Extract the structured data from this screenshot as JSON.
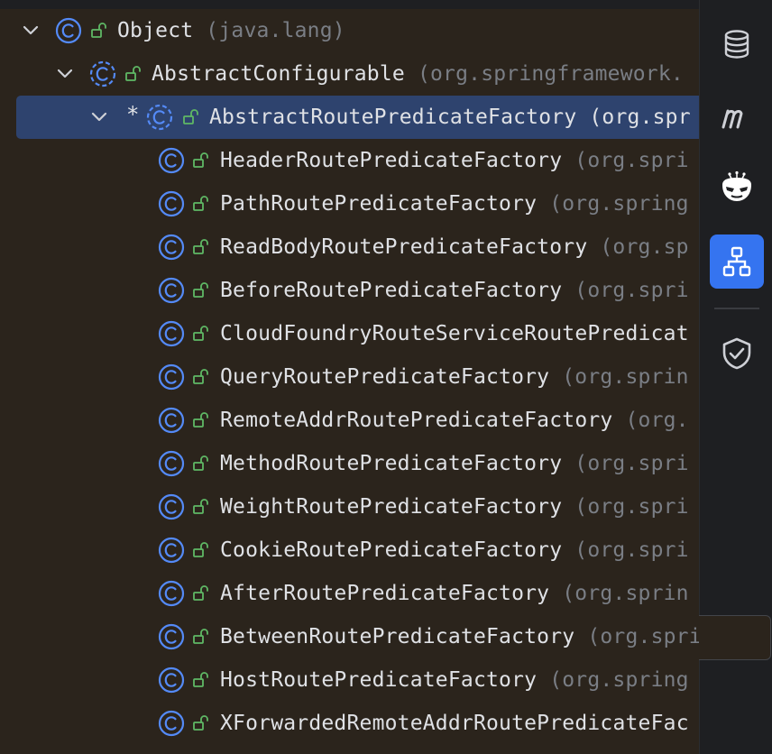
{
  "tree": {
    "rows": [
      {
        "name": "Object",
        "pkg": "(java.lang)",
        "chevron": true,
        "star": false,
        "selected": false
      },
      {
        "name": "AbstractConfigurable",
        "pkg": "(org.springframework.",
        "chevron": true,
        "star": false,
        "selected": false
      },
      {
        "name": "AbstractRoutePredicateFactory",
        "pkg": "(org.spr",
        "chevron": true,
        "star": true,
        "selected": true
      },
      {
        "name": "HeaderRoutePredicateFactory",
        "pkg": "(org.spri",
        "chevron": false,
        "star": false,
        "selected": false
      },
      {
        "name": "PathRoutePredicateFactory",
        "pkg": "(org.spring",
        "chevron": false,
        "star": false,
        "selected": false
      },
      {
        "name": "ReadBodyRoutePredicateFactory",
        "pkg": "(org.sp",
        "chevron": false,
        "star": false,
        "selected": false
      },
      {
        "name": "BeforeRoutePredicateFactory",
        "pkg": "(org.spri",
        "chevron": false,
        "star": false,
        "selected": false
      },
      {
        "name": "CloudFoundryRouteServiceRoutePredicat",
        "pkg": "",
        "chevron": false,
        "star": false,
        "selected": false
      },
      {
        "name": "QueryRoutePredicateFactory",
        "pkg": "(org.sprin",
        "chevron": false,
        "star": false,
        "selected": false
      },
      {
        "name": "RemoteAddrRoutePredicateFactory",
        "pkg": "(org.",
        "chevron": false,
        "star": false,
        "selected": false
      },
      {
        "name": "MethodRoutePredicateFactory",
        "pkg": "(org.spri",
        "chevron": false,
        "star": false,
        "selected": false
      },
      {
        "name": "WeightRoutePredicateFactory",
        "pkg": "(org.spri",
        "chevron": false,
        "star": false,
        "selected": false
      },
      {
        "name": "CookieRoutePredicateFactory",
        "pkg": "(org.spri",
        "chevron": false,
        "star": false,
        "selected": false
      },
      {
        "name": "AfterRoutePredicateFactory",
        "pkg": "(org.sprin",
        "chevron": false,
        "star": false,
        "selected": false
      },
      {
        "name": "BetweenRoutePredicateFactory",
        "pkg": "(org.springfra",
        "chevron": false,
        "star": false,
        "selected": false
      },
      {
        "name": "HostRoutePredicateFactory",
        "pkg": "(org.spring",
        "chevron": false,
        "star": false,
        "selected": false
      },
      {
        "name": "XForwardedRemoteAddrRoutePredicateFac",
        "pkg": "",
        "chevron": false,
        "star": false,
        "selected": false
      }
    ]
  },
  "sidebar": {
    "buttons": [
      {
        "icon": "database-icon",
        "active": false
      },
      {
        "icon": "maven-icon",
        "active": false
      },
      {
        "icon": "mask-plugin-icon",
        "active": false
      },
      {
        "icon": "hierarchy-icon",
        "active": true
      },
      {
        "icon": "shield-check-icon",
        "active": false
      }
    ]
  },
  "colors": {
    "background": "#2b241c",
    "selection": "#2e436e",
    "class_icon": "#548af7",
    "lock_icon": "#5fb865",
    "text": "#dfe1e5",
    "package_text": "#7a7e85",
    "sidebar_bg": "#1e1f22",
    "active_button": "#3574f0"
  }
}
